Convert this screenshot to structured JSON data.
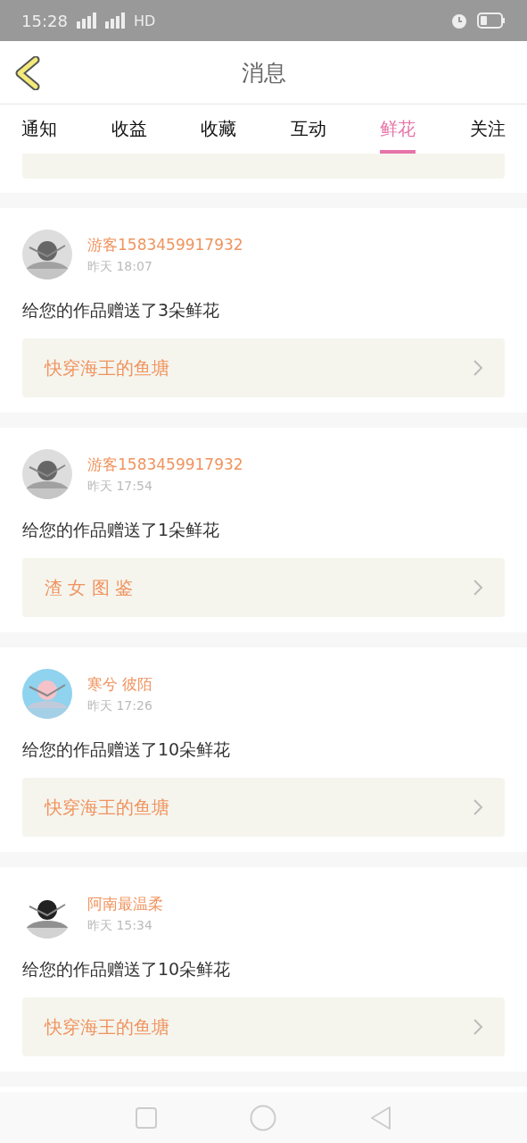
{
  "status_bar": {
    "time": "15:28",
    "network": "HD"
  },
  "header": {
    "title": "消息"
  },
  "tabs": [
    {
      "label": "通知",
      "selected": false
    },
    {
      "label": "收益",
      "selected": false
    },
    {
      "label": "收藏",
      "selected": false
    },
    {
      "label": "互动",
      "selected": false
    },
    {
      "label": "鲜花",
      "selected": true
    },
    {
      "label": "关注",
      "selected": false
    }
  ],
  "messages": [
    {
      "user": "游客1583459917932",
      "time": "昨天 18:07",
      "text": "给您的作品赠送了3朵鲜花",
      "book": "快穿海王的鱼塘"
    },
    {
      "user": "游客1583459917932",
      "time": "昨天 17:54",
      "text": "给您的作品赠送了1朵鲜花",
      "book": "渣 女 图 鉴"
    },
    {
      "user": "寒兮 彼陌",
      "time": "昨天 17:26",
      "text": "给您的作品赠送了10朵鲜花",
      "book": "快穿海王的鱼塘"
    },
    {
      "user": "阿南最温柔",
      "time": "昨天 15:34",
      "text": "给您的作品赠送了10朵鲜花",
      "book": "快穿海王的鱼塘"
    }
  ]
}
